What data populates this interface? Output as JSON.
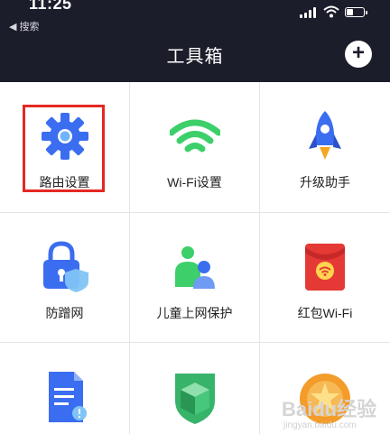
{
  "status_bar": {
    "time": "11:25",
    "back_label": "◀ 搜索"
  },
  "header": {
    "title": "工具箱",
    "add_symbol": "+"
  },
  "tools": [
    {
      "label": "路由设置",
      "icon": "gear-icon"
    },
    {
      "label": "Wi-Fi设置",
      "icon": "wifi-icon"
    },
    {
      "label": "升级助手",
      "icon": "rocket-icon"
    },
    {
      "label": "防蹭网",
      "icon": "lock-shield-icon"
    },
    {
      "label": "儿童上网保护",
      "icon": "children-icon"
    },
    {
      "label": "红包Wi-Fi",
      "icon": "red-envelope-icon"
    },
    {
      "label": "",
      "icon": "document-icon"
    },
    {
      "label": "",
      "icon": "green-shield-icon"
    },
    {
      "label": "",
      "icon": "orange-badge-icon"
    }
  ],
  "watermark": {
    "brand": "Baidu经验",
    "url": "jingyan.baidu.com"
  },
  "colors": {
    "header_bg": "#1c1d2b",
    "accent_blue": "#3b6df0",
    "wifi_green": "#3ccf6a",
    "highlight_red": "#e52822"
  }
}
